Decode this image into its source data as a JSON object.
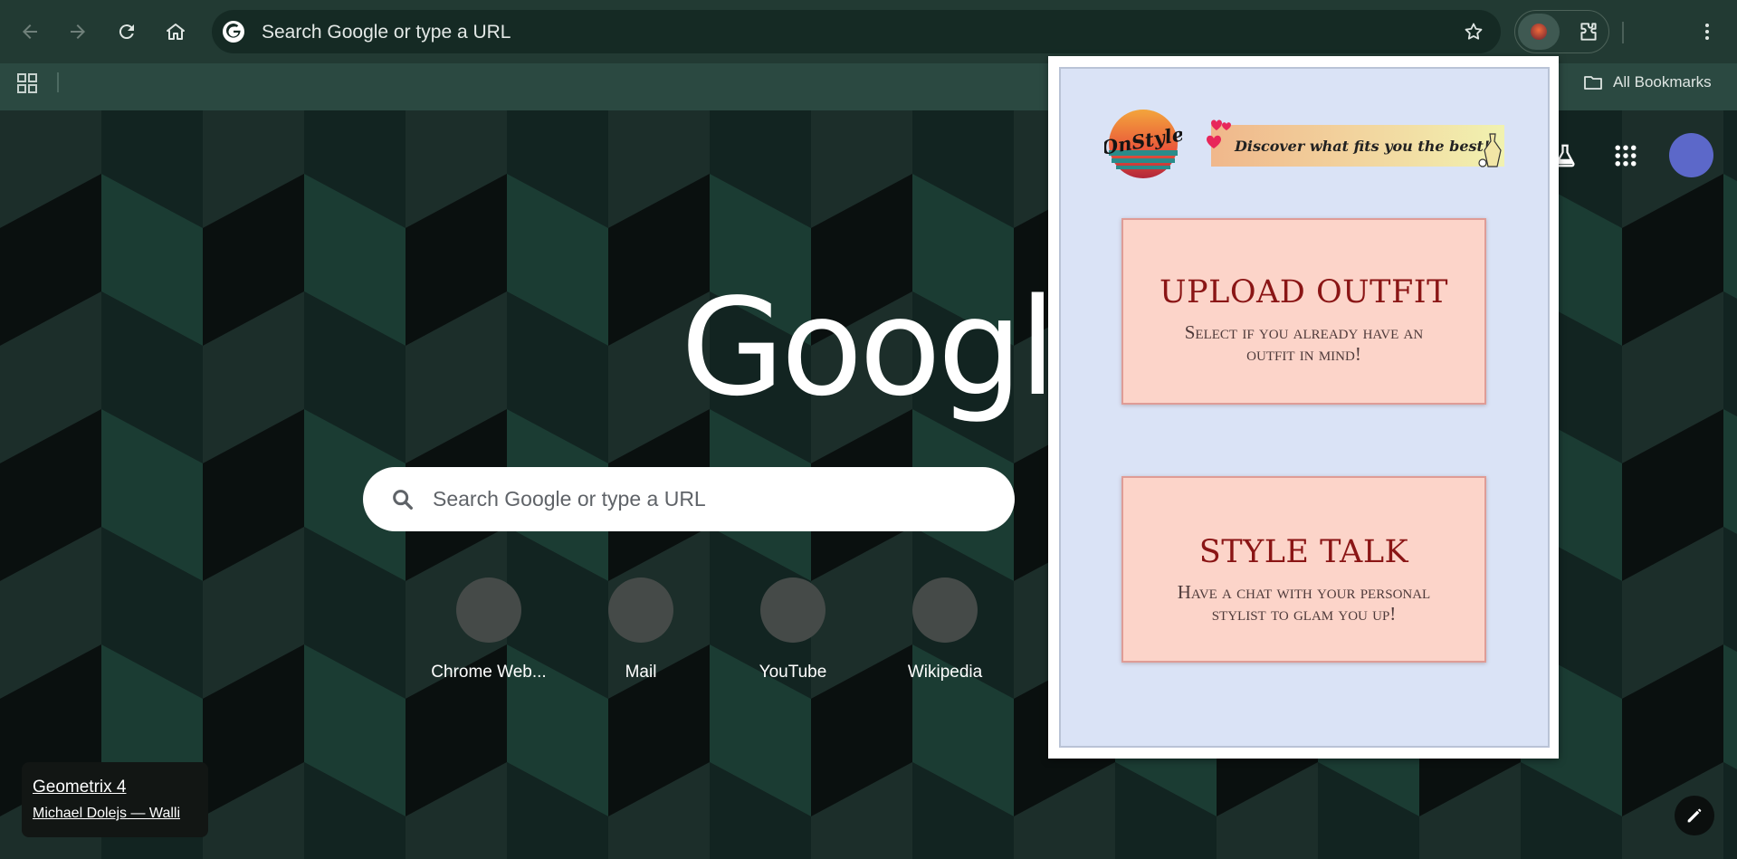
{
  "toolbar": {
    "omnibox_text": "Search Google or type a URL"
  },
  "bookmarks_bar": {
    "all_bookmarks_label": "All Bookmarks"
  },
  "ntp": {
    "logo_text": "Google",
    "search_placeholder": "Search Google or type a URL",
    "shortcuts": [
      {
        "label": "Chrome Web..."
      },
      {
        "label": "Mail"
      },
      {
        "label": "YouTube"
      },
      {
        "label": "Wikipedia"
      }
    ],
    "background_credit": {
      "title": "Geometrix 4",
      "author": "Michael Dolejs — Walli"
    }
  },
  "popup": {
    "logo_text": "OnStyle",
    "tagline": "Discover what fits you the best!",
    "cards": [
      {
        "title": "UPLOAD OUTFIT",
        "subtitle": "Select if you already have an outfit in mind!"
      },
      {
        "title": "STYLE TALK",
        "subtitle": "Have a chat with your personal stylist to glam you up!"
      }
    ]
  },
  "colors": {
    "toolbar_bg": "#223a33",
    "popup_bg": "#dae3f6",
    "card_bg": "#fcd4c9",
    "card_title": "#8a1515",
    "avatar": "#5c68c9"
  }
}
